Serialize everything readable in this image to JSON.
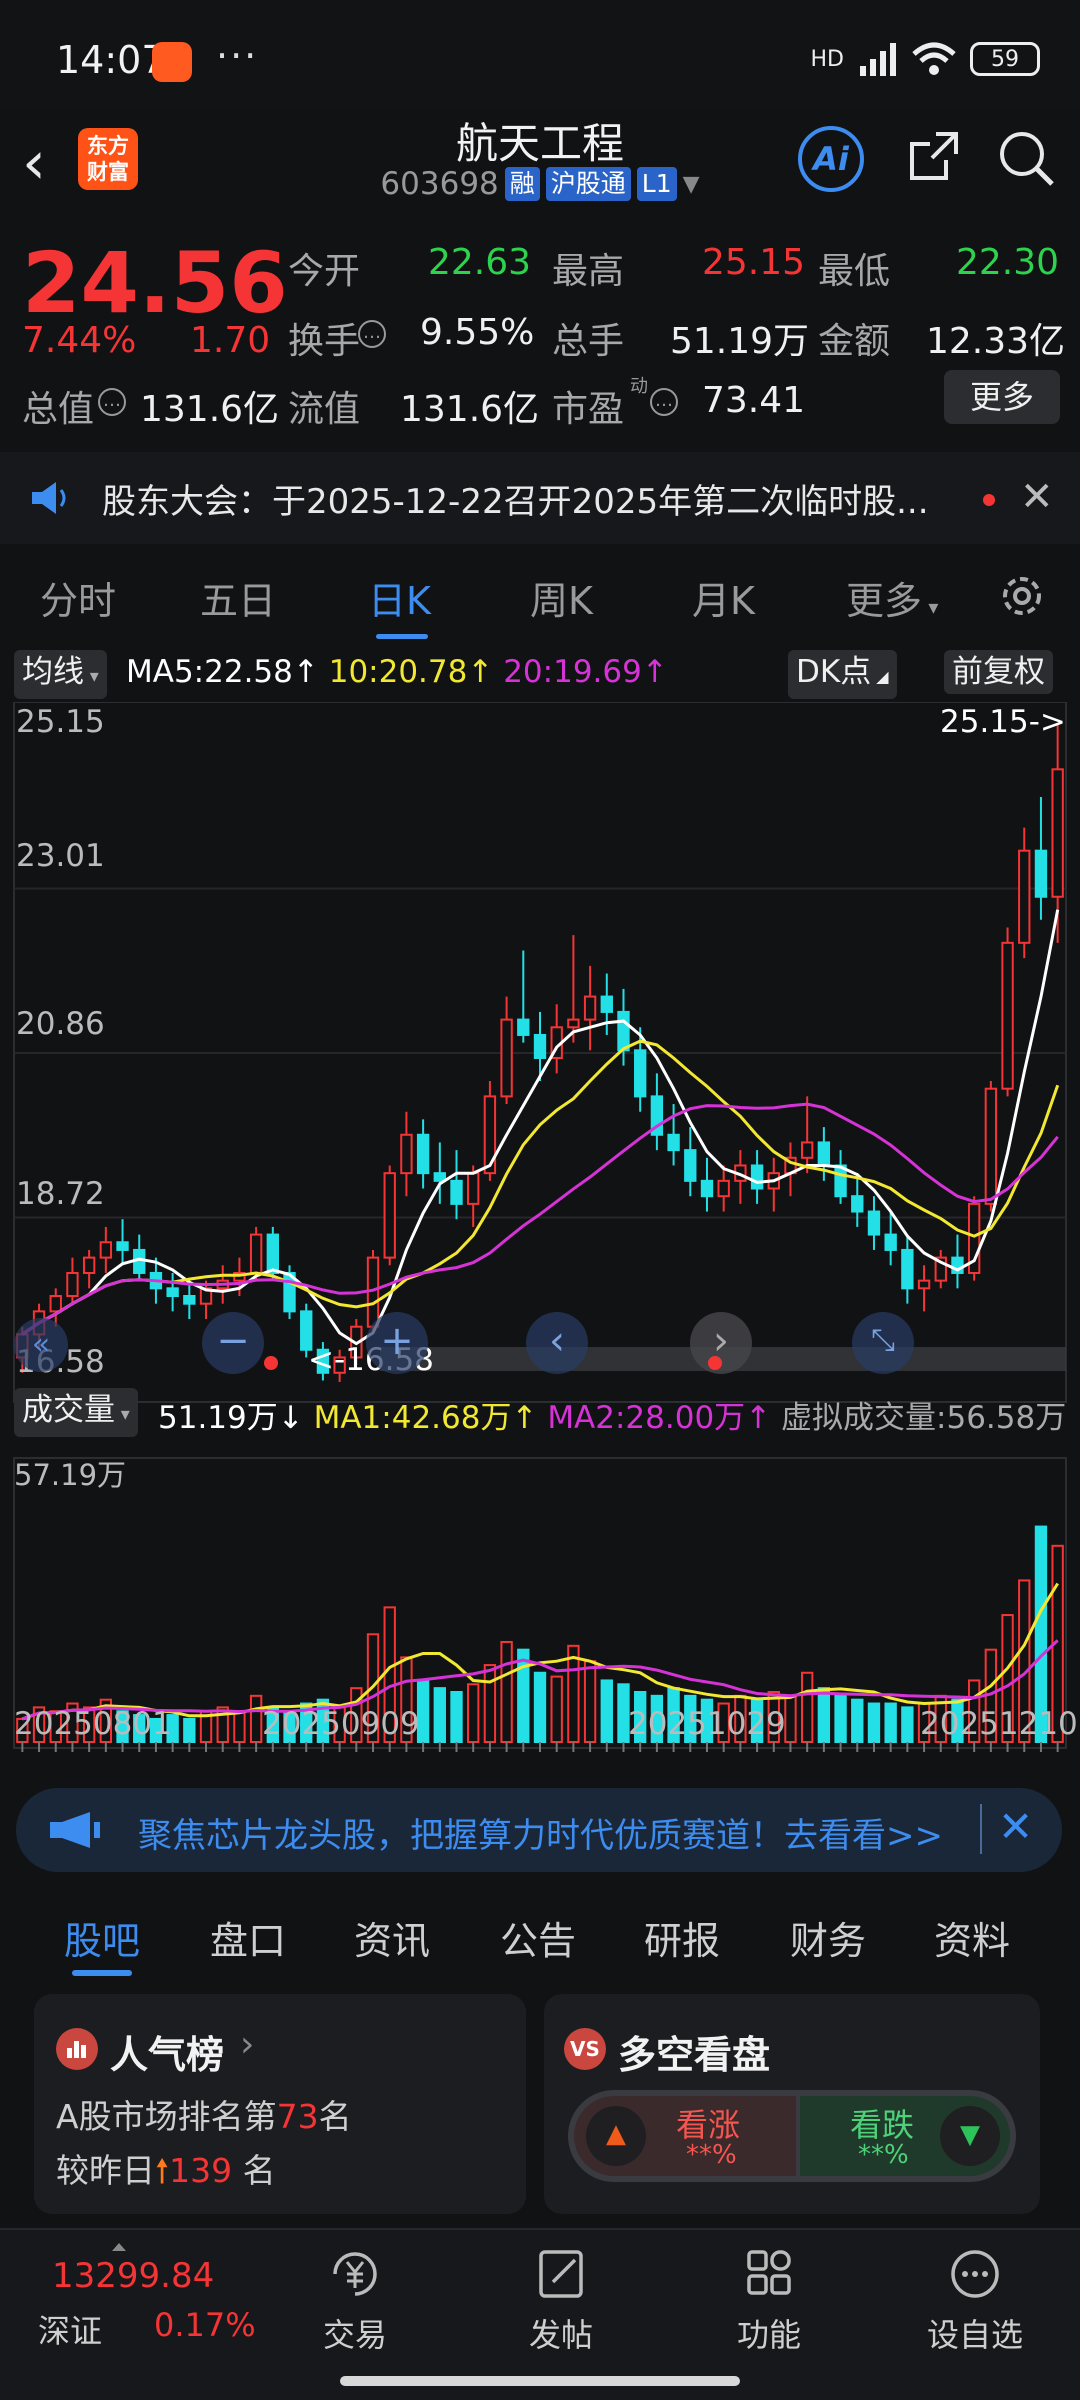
{
  "status_bar": {
    "time": "14:07",
    "more": "···",
    "net": "HD",
    "battery": "59"
  },
  "header": {
    "logo_top": "东方",
    "logo_bottom": "财富",
    "title": "航天工程",
    "code": "603698",
    "tags": [
      "融",
      "沪股通",
      "L1"
    ],
    "ai_label": "Ai"
  },
  "quote": {
    "price": "24.56",
    "change_pct": "7.44%",
    "change": "1.70",
    "open_label": "今开",
    "open": "22.63",
    "high_label": "最高",
    "high": "25.15",
    "low_label": "最低",
    "low": "22.30",
    "turnover_label": "换手",
    "turnover": "9.55%",
    "volume_label": "总手",
    "volume": "51.19万",
    "amount_label": "金额",
    "amount": "12.33亿",
    "mktcap_label": "总值",
    "mktcap": "131.6亿",
    "float_label": "流值",
    "float": "131.6亿",
    "pe_label": "市盈",
    "pe_sup": "动",
    "pe": "73.41",
    "more_label": "更多"
  },
  "notice": {
    "text": "股东大会：于2025-12-22召开2025年第二次临时股..."
  },
  "kline_tabs": {
    "items": [
      "分时",
      "五日",
      "日K",
      "周K",
      "月K",
      "更多"
    ],
    "active": "日K"
  },
  "chart": {
    "indicator": "均线",
    "ma5": "MA5:22.58",
    "ma10": "10:20.78",
    "ma20": "20:19.69",
    "dk": "DK点",
    "adjust": "前复权",
    "y_ticks": [
      "25.15",
      "23.01",
      "20.86",
      "18.72",
      "16.58"
    ],
    "high_marker": "25.15->",
    "low_marker": "<-16.58",
    "vol_label": "成交量",
    "vol_value": "51.19万",
    "vol_ma1": "MA1:42.68万",
    "vol_ma2": "MA2:28.00万",
    "virtual_vol": "虚拟成交量:56.58万",
    "vol_max": "57.19万",
    "x_ticks": [
      "20250801",
      "20250909",
      "20251029",
      "20251210"
    ]
  },
  "chart_data": {
    "type": "candlestick",
    "title": "",
    "ylim": [
      16.58,
      25.15
    ],
    "colors": {
      "up": "#f53535",
      "down": "#22e0e6",
      "ma5": "#ffffff",
      "ma10": "#f2e832",
      "ma20": "#d633d6"
    },
    "ohlc": [
      [
        16.9,
        17.3,
        16.7,
        17.2
      ],
      [
        17.2,
        17.6,
        17.0,
        17.5
      ],
      [
        17.5,
        17.8,
        17.3,
        17.7
      ],
      [
        17.7,
        18.2,
        17.6,
        18.0
      ],
      [
        18.0,
        18.3,
        17.8,
        18.2
      ],
      [
        18.2,
        18.6,
        18.0,
        18.4
      ],
      [
        18.4,
        18.7,
        18.1,
        18.3
      ],
      [
        18.3,
        18.5,
        17.9,
        18.0
      ],
      [
        18.0,
        18.2,
        17.6,
        17.8
      ],
      [
        17.8,
        18.0,
        17.5,
        17.7
      ],
      [
        17.7,
        17.9,
        17.4,
        17.6
      ],
      [
        17.6,
        17.9,
        17.4,
        17.8
      ],
      [
        17.8,
        18.1,
        17.6,
        17.9
      ],
      [
        17.9,
        18.2,
        17.7,
        18.0
      ],
      [
        18.0,
        18.6,
        17.9,
        18.5
      ],
      [
        18.5,
        18.6,
        17.9,
        18.0
      ],
      [
        18.0,
        18.1,
        17.4,
        17.5
      ],
      [
        17.5,
        17.6,
        16.9,
        17.0
      ],
      [
        17.0,
        17.1,
        16.6,
        16.7
      ],
      [
        16.7,
        17.0,
        16.58,
        16.9
      ],
      [
        16.9,
        17.4,
        16.8,
        17.3
      ],
      [
        17.3,
        18.3,
        17.2,
        18.2
      ],
      [
        18.2,
        19.4,
        18.1,
        19.3
      ],
      [
        19.3,
        20.1,
        19.0,
        19.8
      ],
      [
        19.8,
        20.0,
        19.1,
        19.3
      ],
      [
        19.3,
        19.7,
        18.9,
        19.2
      ],
      [
        19.2,
        19.6,
        18.7,
        18.9
      ],
      [
        18.9,
        19.4,
        18.6,
        19.3
      ],
      [
        19.3,
        20.5,
        19.2,
        20.3
      ],
      [
        20.3,
        21.6,
        20.2,
        21.3
      ],
      [
        21.3,
        22.2,
        21.0,
        21.1
      ],
      [
        21.1,
        21.4,
        20.5,
        20.8
      ],
      [
        20.8,
        21.5,
        20.6,
        21.2
      ],
      [
        21.2,
        22.4,
        21.0,
        21.3
      ],
      [
        21.3,
        22.0,
        20.9,
        21.6
      ],
      [
        21.6,
        21.9,
        21.1,
        21.4
      ],
      [
        21.4,
        21.7,
        20.7,
        20.9
      ],
      [
        20.9,
        21.2,
        20.1,
        20.3
      ],
      [
        20.3,
        20.6,
        19.6,
        19.8
      ],
      [
        19.8,
        20.2,
        19.4,
        19.6
      ],
      [
        19.6,
        19.9,
        19.0,
        19.2
      ],
      [
        19.2,
        19.5,
        18.8,
        19.0
      ],
      [
        19.0,
        19.4,
        18.8,
        19.2
      ],
      [
        19.2,
        19.6,
        18.9,
        19.4
      ],
      [
        19.4,
        19.6,
        18.9,
        19.1
      ],
      [
        19.1,
        19.5,
        18.8,
        19.3
      ],
      [
        19.3,
        19.7,
        19.0,
        19.5
      ],
      [
        19.5,
        20.3,
        19.3,
        19.7
      ],
      [
        19.7,
        19.9,
        19.2,
        19.4
      ],
      [
        19.4,
        19.6,
        18.9,
        19.0
      ],
      [
        19.0,
        19.3,
        18.6,
        18.8
      ],
      [
        18.8,
        19.0,
        18.3,
        18.5
      ],
      [
        18.5,
        18.8,
        18.1,
        18.3
      ],
      [
        18.3,
        18.5,
        17.6,
        17.8
      ],
      [
        17.8,
        18.1,
        17.5,
        17.9
      ],
      [
        17.9,
        18.3,
        17.8,
        18.2
      ],
      [
        18.2,
        18.5,
        17.8,
        18.0
      ],
      [
        18.0,
        19.0,
        17.9,
        18.9
      ],
      [
        18.9,
        20.5,
        18.8,
        20.4
      ],
      [
        20.4,
        22.5,
        20.3,
        22.3
      ],
      [
        22.3,
        23.8,
        22.1,
        23.5
      ],
      [
        23.5,
        24.2,
        22.6,
        22.9
      ],
      [
        22.9,
        25.15,
        22.3,
        24.56
      ]
    ],
    "volume_max": 57.19,
    "volume": [
      6,
      9,
      8,
      10,
      9,
      11,
      8,
      7,
      6,
      7,
      6,
      8,
      9,
      8,
      12,
      9,
      8,
      10,
      11,
      9,
      14,
      28,
      35,
      22,
      16,
      14,
      13,
      15,
      20,
      26,
      24,
      18,
      17,
      25,
      21,
      16,
      15,
      13,
      12,
      14,
      12,
      11,
      10,
      12,
      11,
      13,
      12,
      18,
      14,
      12,
      11,
      10,
      10,
      9,
      10,
      12,
      11,
      16,
      24,
      33,
      42,
      56,
      51
    ]
  },
  "ad": {
    "text": "聚焦芯片龙头股，把握算力时代优质赛道！去看看>>"
  },
  "bottom_tabs": {
    "items": [
      "股吧",
      "盘口",
      "资讯",
      "公告",
      "研报",
      "财务",
      "资料"
    ],
    "active": "股吧"
  },
  "cards": {
    "popularity": {
      "title": "人气榜",
      "line1_pre": "A股市场排名第",
      "rank": "73",
      "line1_post": "名",
      "line2_pre": "较昨日",
      "change": "139",
      "line2_post": " 名"
    },
    "vote": {
      "title": "多空看盘",
      "bull": "看涨",
      "bull_pct": "**%",
      "bear": "看跌",
      "bear_pct": "**%"
    }
  },
  "bottom_nav": {
    "index_value": "13299.84",
    "index_name": "深证",
    "index_pct": "0.17%",
    "items": [
      "交易",
      "发帖",
      "功能",
      "设自选"
    ]
  }
}
